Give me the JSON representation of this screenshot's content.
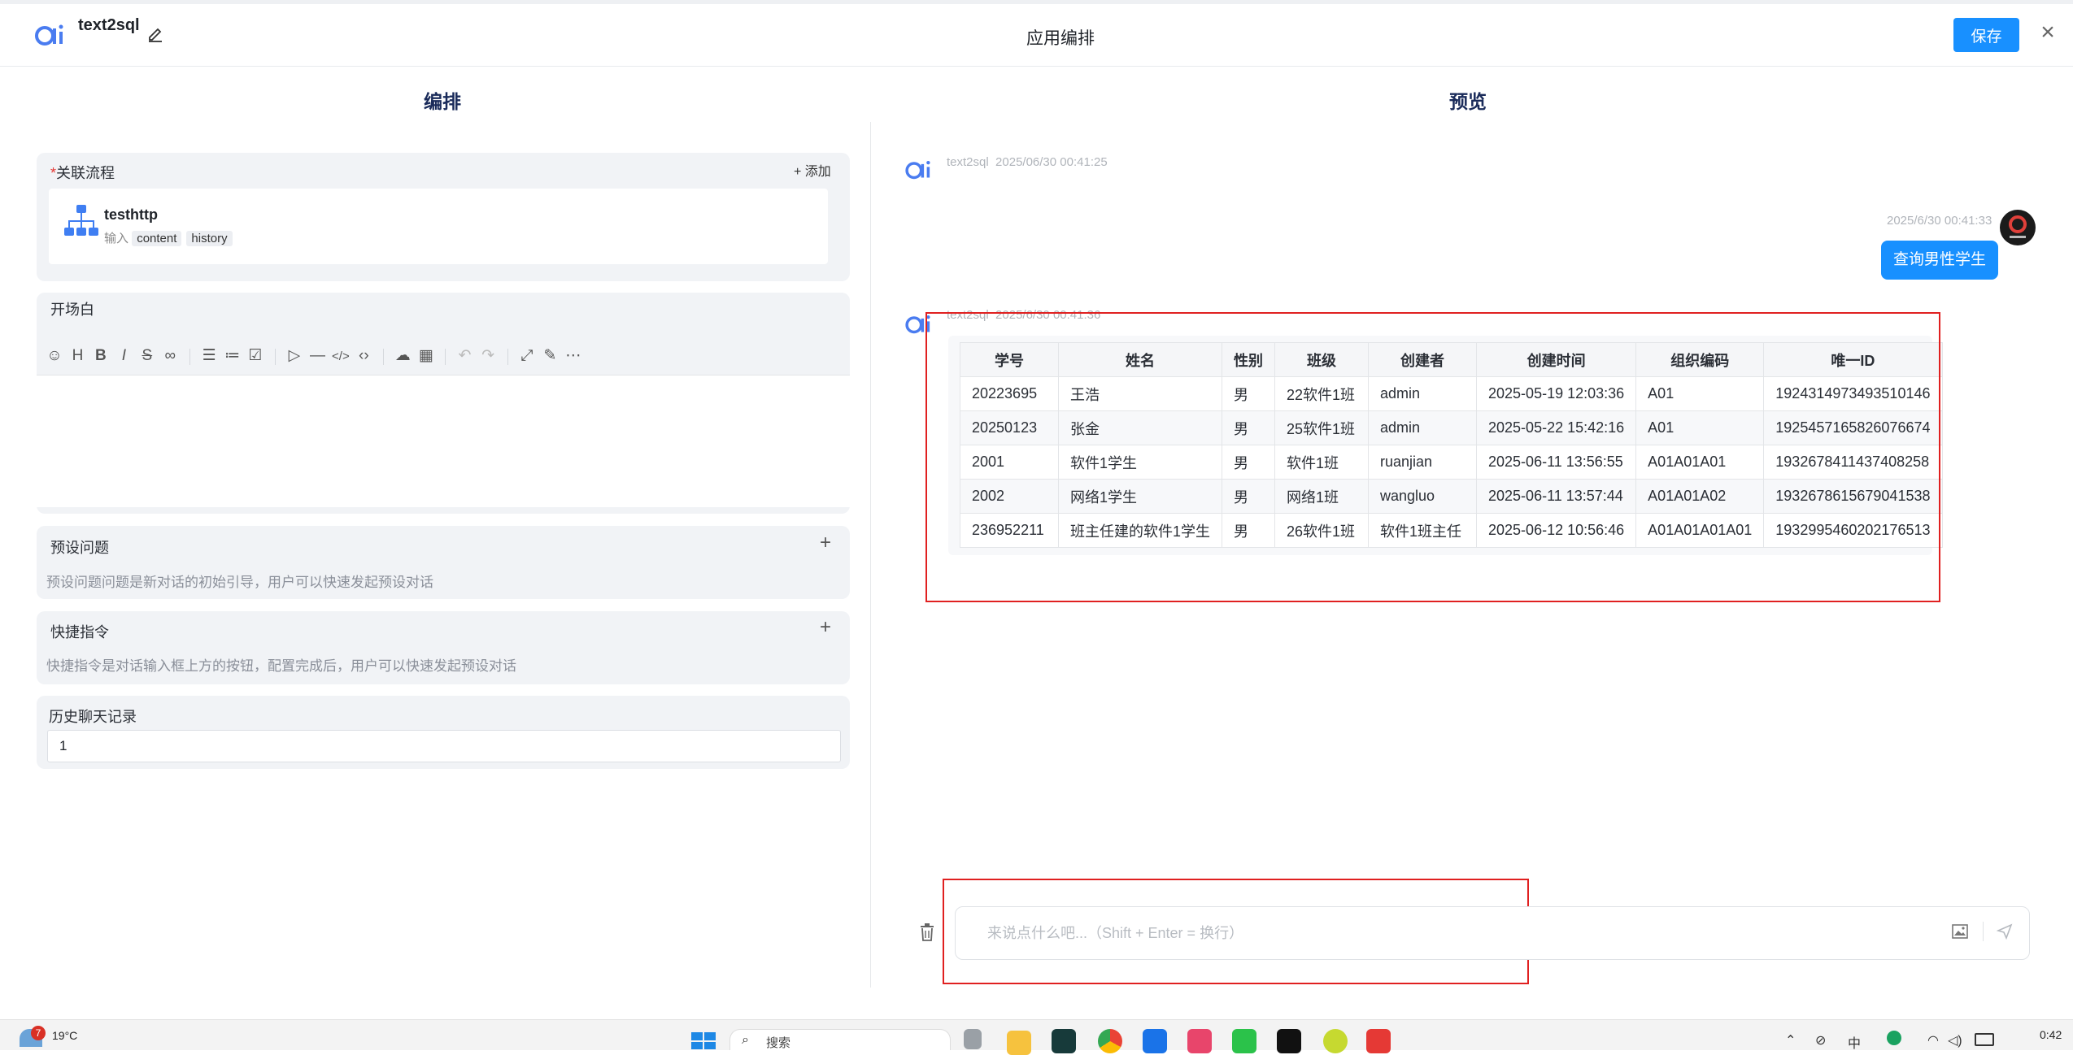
{
  "header": {
    "app_name": "text2sql",
    "title": "应用编排",
    "save_label": "保存"
  },
  "left": {
    "title": "编排",
    "flow": {
      "required_mark": "*",
      "label": "关联流程",
      "add_label": "+ 添加",
      "name": "testhttp",
      "input_label": "输入",
      "inputs": [
        "content",
        "history"
      ]
    },
    "opening": {
      "label": "开场白"
    },
    "preset": {
      "label": "预设问题",
      "hint": "预设问题问题是新对话的初始引导，用户可以快速发起预设对话"
    },
    "shortcut": {
      "label": "快捷指令",
      "hint": "快捷指令是对话输入框上方的按钮，配置完成后，用户可以快速发起预设对话"
    },
    "history": {
      "label": "历史聊天记录",
      "value": "1"
    }
  },
  "right": {
    "title": "预览",
    "msg1": {
      "sender": "text2sql",
      "time": "2025/06/30 00:41:25"
    },
    "user_msg": {
      "time": "2025/6/30 00:41:33",
      "text": "查询男性学生"
    },
    "msg2": {
      "sender": "text2sql",
      "time": "2025/6/30 00:41:36"
    },
    "table": {
      "headers": [
        "学号",
        "姓名",
        "性别",
        "班级",
        "创建者",
        "创建时间",
        "组织编码",
        "唯一ID"
      ],
      "rows": [
        [
          "20223695",
          "王浩",
          "男",
          "22软件1班",
          "admin",
          "2025-05-19 12:03:36",
          "A01",
          "1924314973493510146"
        ],
        [
          "20250123",
          "张金",
          "男",
          "25软件1班",
          "admin",
          "2025-05-22 15:42:16",
          "A01",
          "1925457165826076674"
        ],
        [
          "2001",
          "软件1学生",
          "男",
          "软件1班",
          "ruanjian",
          "2025-06-11 13:56:55",
          "A01A01A01",
          "1932678411437408258"
        ],
        [
          "2002",
          "网络1学生",
          "男",
          "网络1班",
          "wangluo",
          "2025-06-11 13:57:44",
          "A01A01A02",
          "1932678615679041538"
        ],
        [
          "236952211",
          "班主任建的软件1学生",
          "男",
          "26软件1班",
          "软件1班主任",
          "2025-06-12 10:56:46",
          "A01A01A01A01",
          "1932995460202176513"
        ]
      ]
    },
    "input_placeholder": "来说点什么吧...（Shift + Enter = 换行）"
  },
  "taskbar": {
    "badge": "7",
    "weather": "19°C",
    "search_placeholder": "搜索",
    "ime": "中",
    "time": "0:42"
  }
}
